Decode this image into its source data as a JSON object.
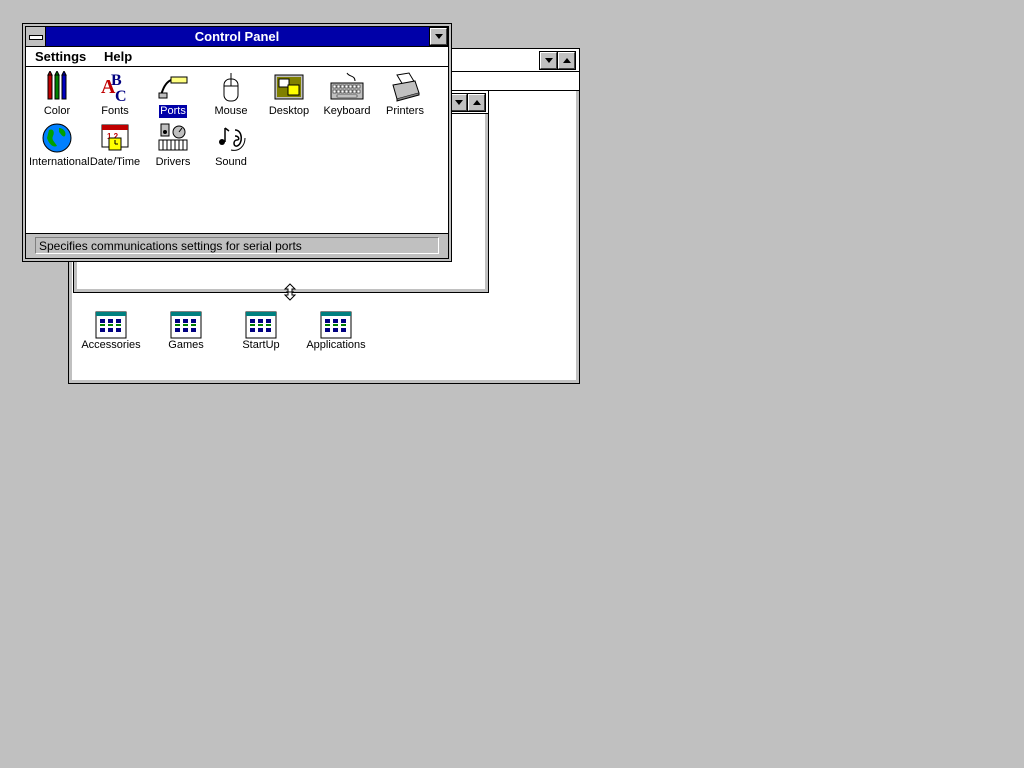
{
  "control_panel": {
    "title": "Control Panel",
    "menu": [
      {
        "label": "Settings"
      },
      {
        "label": "Help"
      }
    ],
    "icons": [
      {
        "label": "Color",
        "icon": "color-icon"
      },
      {
        "label": "Fonts",
        "icon": "fonts-icon"
      },
      {
        "label": "Ports",
        "icon": "ports-icon",
        "selected": true
      },
      {
        "label": "Mouse",
        "icon": "mouse-icon"
      },
      {
        "label": "Desktop",
        "icon": "desktop-icon"
      },
      {
        "label": "Keyboard",
        "icon": "keyboard-icon"
      },
      {
        "label": "Printers",
        "icon": "printer-icon"
      },
      {
        "label": "International",
        "icon": "globe-icon"
      },
      {
        "label": "Date/Time",
        "icon": "clock-calendar-icon"
      },
      {
        "label": "Drivers",
        "icon": "drivers-icon"
      },
      {
        "label": "Sound",
        "icon": "sound-icon"
      }
    ],
    "status_text": "Specifies communications settings for serial ports"
  },
  "program_manager": {
    "groups": [
      {
        "label": "Accessories",
        "icon": "program-group-icon"
      },
      {
        "label": "Games",
        "icon": "program-group-icon"
      },
      {
        "label": "StartUp",
        "icon": "program-group-icon"
      },
      {
        "label": "Applications",
        "icon": "program-group-icon"
      }
    ]
  },
  "colors": {
    "desktop": "#c0c0c0",
    "titlebar_active": "#0000a8",
    "selection": "#0000a8"
  }
}
